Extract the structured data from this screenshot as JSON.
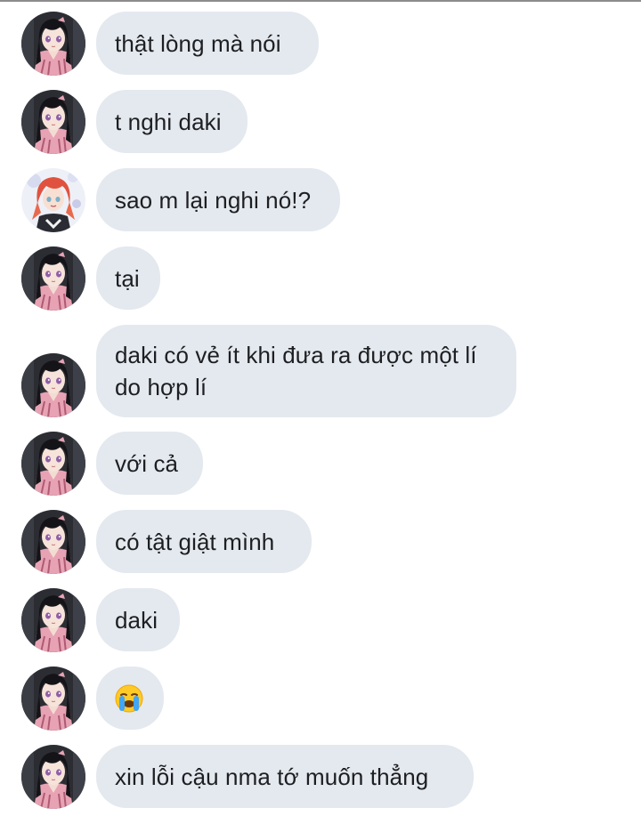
{
  "conversation": {
    "messages": [
      {
        "sender": "girl",
        "text": "thật lòng mà nói"
      },
      {
        "sender": "girl",
        "text": "t nghi daki"
      },
      {
        "sender": "redhair",
        "text": "sao m lại nghi nó!?"
      },
      {
        "sender": "girl",
        "text": "tại"
      },
      {
        "sender": "girl",
        "text": "daki có vẻ ít khi đưa ra được một lí do hợp lí"
      },
      {
        "sender": "girl",
        "text": "với cả"
      },
      {
        "sender": "girl",
        "text": "có tật giật mình"
      },
      {
        "sender": "girl",
        "text": "daki"
      },
      {
        "sender": "girl",
        "emoji": "loudly-crying-face"
      },
      {
        "sender": "girl",
        "text": "xin lỗi cậu nma tớ muốn thẳng"
      }
    ]
  },
  "colors": {
    "bubble_bg": "#e4e9ef",
    "text": "#1d1f22",
    "divider": "#8c8c8c"
  }
}
